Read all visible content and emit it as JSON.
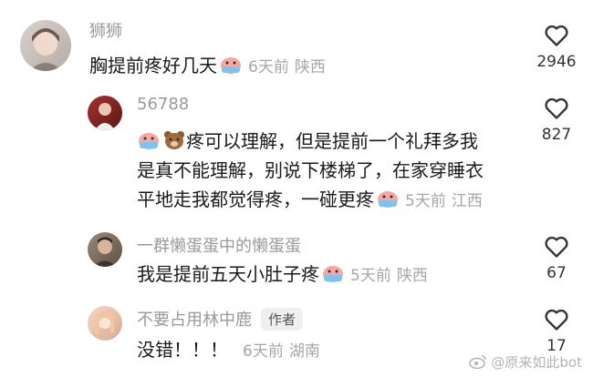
{
  "comments": [
    {
      "author": "狮狮",
      "lines": [
        "胸提前疼好几天"
      ],
      "time": "6天前",
      "location": "陕西",
      "likes": "2946"
    },
    {
      "author": "56788",
      "lines": [
        "疼可以理解，但是提前一个礼拜多我",
        "是真不能理解，别说下楼梯了，在家穿睡衣",
        "平地走我都觉得疼，一碰更疼"
      ],
      "time": "5天前",
      "location": "江西",
      "likes": "827"
    },
    {
      "author": "一群懒蛋蛋中的懒蛋蛋",
      "lines": [
        "我是提前五天小肚子疼"
      ],
      "time": "5天前",
      "location": "陕西",
      "likes": "67"
    },
    {
      "author": "不要占用林中鹿",
      "author_badge": "作者",
      "lines": [
        "没错！！！"
      ],
      "time": "6天前",
      "location": "湖南",
      "likes": "17"
    }
  ],
  "watermark": "@原来如此bot",
  "icons": [
    "heart-icon",
    "crying-emoji-icon",
    "bear-emoji-icon",
    "weibo-logo-icon"
  ]
}
